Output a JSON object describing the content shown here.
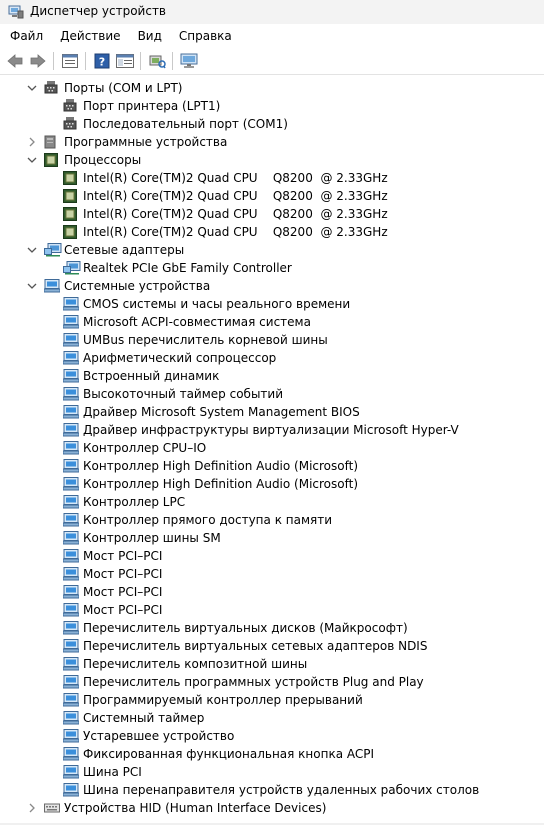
{
  "window": {
    "title": "Диспетчер устройств"
  },
  "menu": [
    {
      "label": "Файл"
    },
    {
      "label": "Действие"
    },
    {
      "label": "Вид"
    },
    {
      "label": "Справка"
    }
  ],
  "toolbar": {
    "buttons": [
      {
        "name": "back-button",
        "icon": "arrow-left-icon"
      },
      {
        "name": "forward-button",
        "icon": "arrow-right-icon"
      },
      {
        "sep": true
      },
      {
        "name": "properties-button",
        "icon": "properties-icon"
      },
      {
        "sep": true
      },
      {
        "name": "help-button",
        "icon": "help-icon"
      },
      {
        "name": "show-hide-console-tree-button",
        "icon": "console-tree-icon"
      },
      {
        "sep": true
      },
      {
        "name": "scan-hardware-button",
        "icon": "scan-hardware-icon"
      },
      {
        "sep": true
      },
      {
        "name": "monitor-button",
        "icon": "monitor-icon"
      }
    ]
  },
  "tree": [
    {
      "level": 0,
      "chevron": "down",
      "icon": "port-icon",
      "label": "Порты (COM и LPT)"
    },
    {
      "level": 1,
      "icon": "port-icon",
      "label": "Порт принтера (LPT1)"
    },
    {
      "level": 1,
      "icon": "port-icon",
      "label": "Последовательный порт (COM1)"
    },
    {
      "level": 0,
      "chevron": "right",
      "icon": "software-device-icon",
      "label": "Программные устройства"
    },
    {
      "level": 0,
      "chevron": "down",
      "icon": "processor-icon",
      "label": "Процессоры"
    },
    {
      "level": 1,
      "icon": "processor-icon",
      "label": "Intel(R) Core(TM)2 Quad CPU    Q8200  @ 2.33GHz"
    },
    {
      "level": 1,
      "icon": "processor-icon",
      "label": "Intel(R) Core(TM)2 Quad CPU    Q8200  @ 2.33GHz"
    },
    {
      "level": 1,
      "icon": "processor-icon",
      "label": "Intel(R) Core(TM)2 Quad CPU    Q8200  @ 2.33GHz"
    },
    {
      "level": 1,
      "icon": "processor-icon",
      "label": "Intel(R) Core(TM)2 Quad CPU    Q8200  @ 2.33GHz"
    },
    {
      "level": 0,
      "chevron": "down",
      "icon": "network-adapter-icon",
      "label": "Сетевые адаптеры"
    },
    {
      "level": 1,
      "icon": "network-adapter-icon",
      "label": "Realtek PCIe GbE Family Controller"
    },
    {
      "level": 0,
      "chevron": "down",
      "icon": "system-device-icon",
      "label": "Системные устройства"
    },
    {
      "level": 1,
      "icon": "system-device-icon",
      "label": "CMOS системы и часы реального времени"
    },
    {
      "level": 1,
      "icon": "system-device-icon",
      "label": "Microsoft ACPI-совместимая система"
    },
    {
      "level": 1,
      "icon": "system-device-icon",
      "label": "UMBus перечислитель корневой шины"
    },
    {
      "level": 1,
      "icon": "system-device-icon",
      "label": "Арифметический сопроцессор"
    },
    {
      "level": 1,
      "icon": "system-device-icon",
      "label": "Встроенный динамик"
    },
    {
      "level": 1,
      "icon": "system-device-icon",
      "label": "Высокоточный таймер событий"
    },
    {
      "level": 1,
      "icon": "system-device-icon",
      "label": "Драйвер Microsoft System Management BIOS"
    },
    {
      "level": 1,
      "icon": "system-device-icon",
      "label": "Драйвер инфраструктуры виртуализации Microsoft Hyper-V"
    },
    {
      "level": 1,
      "icon": "system-device-icon",
      "label": "Контроллер CPU–IO"
    },
    {
      "level": 1,
      "icon": "system-device-icon",
      "label": "Контроллер High Definition Audio (Microsoft)"
    },
    {
      "level": 1,
      "icon": "system-device-icon",
      "label": "Контроллер High Definition Audio (Microsoft)"
    },
    {
      "level": 1,
      "icon": "system-device-icon",
      "label": "Контроллер LPC"
    },
    {
      "level": 1,
      "icon": "system-device-icon",
      "label": "Контроллер прямого доступа к памяти"
    },
    {
      "level": 1,
      "icon": "system-device-icon",
      "label": "Контроллер шины SM"
    },
    {
      "level": 1,
      "icon": "system-device-icon",
      "label": "Мост PCI–PCI"
    },
    {
      "level": 1,
      "icon": "system-device-icon",
      "label": "Мост PCI–PCI"
    },
    {
      "level": 1,
      "icon": "system-device-icon",
      "label": "Мост PCI–PCI"
    },
    {
      "level": 1,
      "icon": "system-device-icon",
      "label": "Мост PCI–PCI"
    },
    {
      "level": 1,
      "icon": "system-device-icon",
      "label": "Перечислитель виртуальных дисков (Майкрософт)"
    },
    {
      "level": 1,
      "icon": "system-device-icon",
      "label": "Перечислитель виртуальных сетевых адаптеров NDIS"
    },
    {
      "level": 1,
      "icon": "system-device-icon",
      "label": "Перечислитель композитной шины"
    },
    {
      "level": 1,
      "icon": "system-device-icon",
      "label": "Перечислитель программных устройств Plug and Play"
    },
    {
      "level": 1,
      "icon": "system-device-icon",
      "label": "Программируемый контроллер прерываний"
    },
    {
      "level": 1,
      "icon": "system-device-icon",
      "label": "Системный таймер"
    },
    {
      "level": 1,
      "icon": "system-device-icon",
      "label": "Устаревшее устройство"
    },
    {
      "level": 1,
      "icon": "system-device-icon",
      "label": "Фиксированная функциональная кнопка ACPI"
    },
    {
      "level": 1,
      "icon": "system-device-icon",
      "label": "Шина PCI"
    },
    {
      "level": 1,
      "icon": "system-device-icon",
      "label": "Шина перенаправителя устройств удаленных рабочих столов"
    },
    {
      "level": 0,
      "chevron": "right",
      "icon": "hid-icon",
      "label": "Устройства HID (Human Interface Devices)"
    }
  ]
}
